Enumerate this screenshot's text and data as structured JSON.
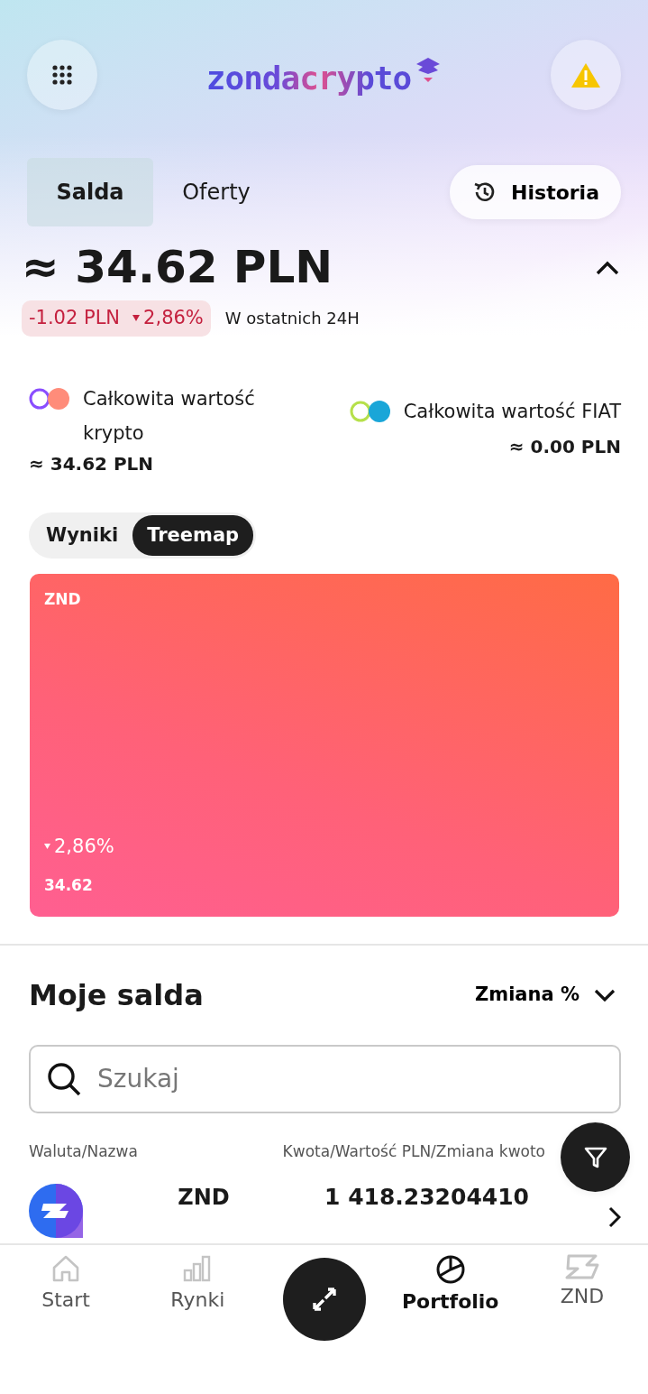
{
  "header": {
    "logo": "zondacrypto"
  },
  "tabs": [
    {
      "label": "Salda",
      "selected": true
    },
    {
      "label": "Oferty",
      "selected": false
    }
  ],
  "history_button": "Historia",
  "balance": {
    "total": "≈ 34.62 PLN",
    "change_amount": "-1.02 PLN",
    "change_percent": "2,86%",
    "falling": true,
    "period": "W ostatnich 24H",
    "expanded": true
  },
  "summary": [
    {
      "label": "Całkowita wartość krypto",
      "value": "≈ 34.62 PLN",
      "kind": "crypto"
    },
    {
      "label": "Całkowita wartość FIAT",
      "value": "≈ 0.00 PLN",
      "kind": "fiat"
    }
  ],
  "view_toggle": [
    {
      "label": "Wyniki",
      "selected": false
    },
    {
      "label": "Treemap",
      "selected": true
    }
  ],
  "treemap": {
    "tiles": [
      {
        "symbol": "ZND",
        "change": "2,86%",
        "falling": true,
        "value": "34.62"
      }
    ]
  },
  "balances": {
    "title": "Moje salda",
    "sort": "Zmiana %",
    "search": {
      "placeholder": "Szukaj"
    },
    "columns": [
      "Waluta/Nazwa",
      "Kwota/Wartość PLN/Zmiana kwoto"
    ],
    "rows": [
      {
        "symbol": "ZND",
        "amount": "1 418.23204410"
      }
    ]
  },
  "bottom_nav": [
    {
      "label": "Start",
      "kind": "home",
      "selected": false
    },
    {
      "label": "Rynki",
      "kind": "markets",
      "selected": false
    },
    {
      "kind": "exchange",
      "selected": false
    },
    {
      "label": "Portfolio",
      "kind": "portfolio",
      "selected": true
    },
    {
      "label": "ZND",
      "kind": "znd",
      "selected": false
    }
  ]
}
